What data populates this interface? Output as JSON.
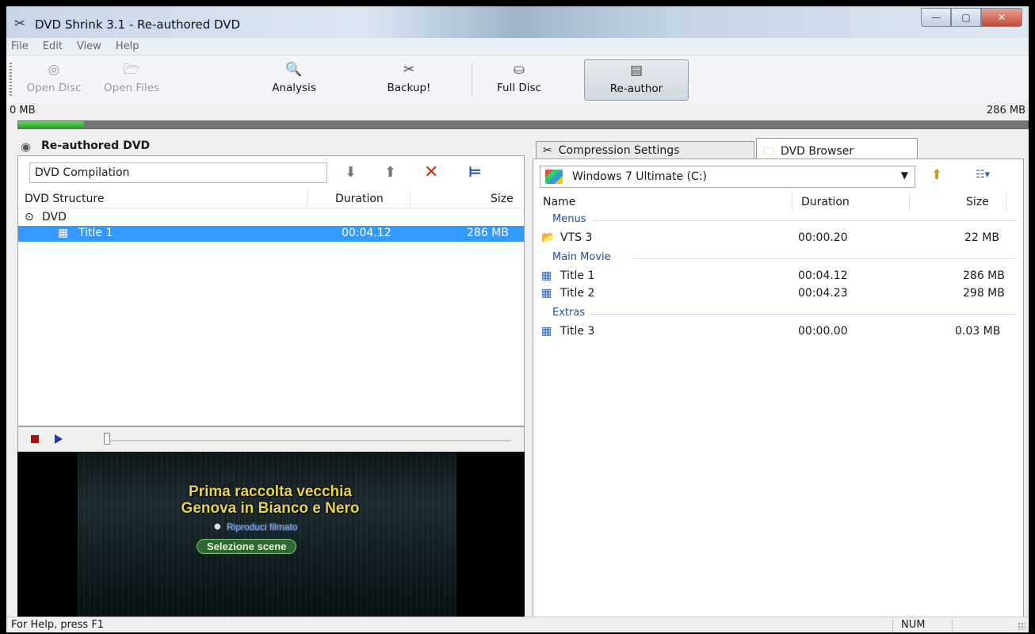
{
  "window": {
    "title": "DVD Shrink 3.1 - Re-authored DVD",
    "controls": {
      "minimize": "—",
      "maximize": "▢",
      "close": "✕"
    }
  },
  "menu": [
    "File",
    "Edit",
    "View",
    "Help"
  ],
  "toolbar": {
    "open_disc": "Open Disc",
    "open_files": "Open Files",
    "analysis": "Analysis",
    "backup": "Backup!",
    "full_disc": "Full Disc",
    "re_author": "Re-author"
  },
  "size_bar": {
    "left_label": "0 MB",
    "right_label": "286 MB",
    "fill_fraction": 0.065
  },
  "left": {
    "header": "Re-authored DVD",
    "compilation_name": "DVD Compilation",
    "columns": {
      "structure": "DVD Structure",
      "duration": "Duration",
      "size": "Size"
    },
    "tree": {
      "root": "DVD",
      "items": [
        {
          "name": "Title 1",
          "duration": "00:04.12",
          "size": "286 MB"
        }
      ]
    }
  },
  "preview": {
    "title_line1": "Prima raccolta vecchia",
    "title_line2": "Genova in Bianco e Nero",
    "subtitle": "Riproduci filmato",
    "button": "Selezione scene"
  },
  "tabs": {
    "compression": "Compression Settings",
    "browser": "DVD Browser"
  },
  "browser": {
    "drive": "Windows 7 Ultimate (C:)",
    "columns": {
      "name": "Name",
      "duration": "Duration",
      "size": "Size"
    },
    "groups": {
      "menus": "Menus",
      "main_movie": "Main Movie",
      "extras": "Extras"
    },
    "rows": {
      "vts3": {
        "name": "VTS 3",
        "duration": "00:00.20",
        "size": "22 MB"
      },
      "title1": {
        "name": "Title 1",
        "duration": "00:04.12",
        "size": "286 MB"
      },
      "title2": {
        "name": "Title 2",
        "duration": "00:04.23",
        "size": "298 MB"
      },
      "title3": {
        "name": "Title 3",
        "duration": "00:00.00",
        "size": "0.03 MB"
      }
    }
  },
  "status": {
    "help": "For Help, press F1",
    "num": "NUM"
  },
  "colors": {
    "selection": "#3399ff",
    "progress": "#1ea31e",
    "group_text": "#1e4e9a"
  }
}
